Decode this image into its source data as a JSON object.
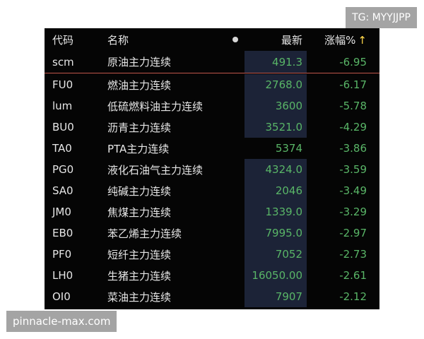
{
  "watermark_top": "TG: MYYJJPP",
  "watermark_bottom": "pinnacle-max.com",
  "header": {
    "code": "代码",
    "name": "名称",
    "last": "最新",
    "change": "涨幅%",
    "sort_arrow": "↑"
  },
  "colors": {
    "up": "#59b567",
    "cell_bg": "#1c2337",
    "accent": "#ffd84a",
    "divider": "#c1564a"
  },
  "rows": [
    {
      "code": "scm",
      "name": "原油主力连续",
      "last": "491.3",
      "change": "-6.95"
    },
    {
      "code": "FU0",
      "name": "燃油主力连续",
      "last": "2768.0",
      "change": "-6.17"
    },
    {
      "code": "lum",
      "name": "低硫燃料油主力连续",
      "last": "3600",
      "change": "-5.78"
    },
    {
      "code": "BU0",
      "name": "沥青主力连续",
      "last": "3521.0",
      "change": "-4.29"
    },
    {
      "code": "TA0",
      "name": "PTA主力连续",
      "last": "5374",
      "change": "-3.86"
    },
    {
      "code": "PG0",
      "name": "液化石油气主力连续",
      "last": "4324.0",
      "change": "-3.59"
    },
    {
      "code": "SA0",
      "name": "纯碱主力连续",
      "last": "2046",
      "change": "-3.49"
    },
    {
      "code": "JM0",
      "name": "焦煤主力连续",
      "last": "1339.0",
      "change": "-3.29"
    },
    {
      "code": "EB0",
      "name": "苯乙烯主力连续",
      "last": "7995.0",
      "change": "-2.97"
    },
    {
      "code": "PF0",
      "name": "短纤主力连续",
      "last": "7052",
      "change": "-2.73"
    },
    {
      "code": "LH0",
      "name": "生猪主力连续",
      "last": "16050.00",
      "change": "-2.61"
    },
    {
      "code": "OI0",
      "name": "菜油主力连续",
      "last": "7907",
      "change": "-2.12"
    }
  ]
}
